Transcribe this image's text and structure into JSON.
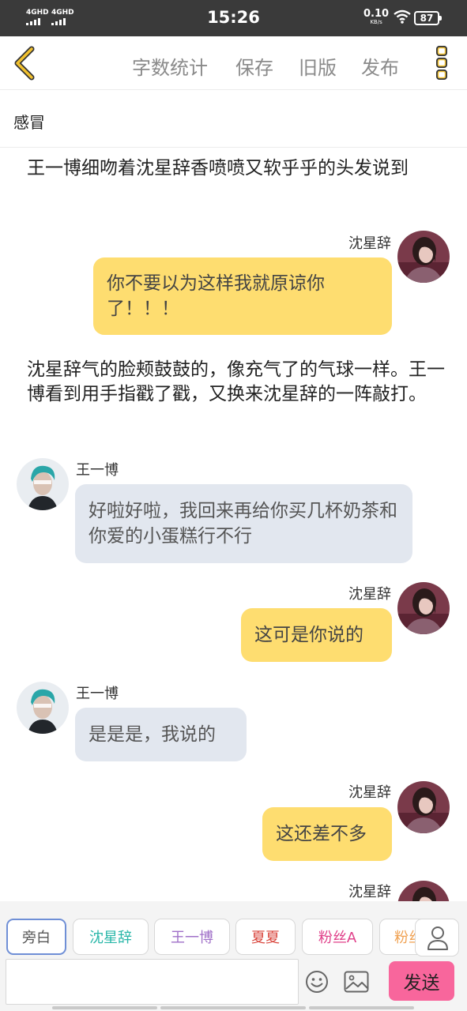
{
  "status_bar": {
    "signal1": "4GHD",
    "signal2": "4GHD",
    "time": "15:26",
    "net_speed": "0.10",
    "net_unit": "KB/s",
    "battery": "87"
  },
  "header": {
    "back_icon": "chevron-left-icon",
    "menu": [
      "字数统计",
      "保存",
      "旧版",
      "发布"
    ],
    "more_icon": "three-dots-vertical-icon",
    "accent": "#f2c12e"
  },
  "title": "感冒",
  "chat": {
    "narration_1": "王一博细吻着沈星辞香喷喷又软乎乎的头发说到",
    "narration_2": "沈星辞气的脸颊鼓鼓的，像充气了的气球一样。王一博看到用手指戳了戳，又换来沈星辞的一阵敲打。",
    "messages": [
      {
        "speaker": "沈星辞",
        "text": "你不要以为这样我就原谅你了！！！"
      },
      {
        "speaker": "王一博",
        "text": "好啦好啦，我回来再给你买几杯奶茶和你爱的小蛋糕行不行"
      },
      {
        "speaker": "沈星辞",
        "text": "这可是你说的"
      },
      {
        "speaker": "王一博",
        "text": "是是是，我说的"
      },
      {
        "speaker": "沈星辞",
        "text": "这还差不多"
      },
      {
        "speaker": "沈星辞",
        "text": ""
      }
    ],
    "bubble_me_color": "#fedd70",
    "bubble_other_color": "#e2e7ef"
  },
  "bottom": {
    "roles": [
      {
        "label": "旁白",
        "color": "#555555"
      },
      {
        "label": "沈星辞",
        "color": "#2ab7a9"
      },
      {
        "label": "王一博",
        "color": "#a070c8"
      },
      {
        "label": "夏夏",
        "color": "#d8433a"
      },
      {
        "label": "粉丝A",
        "color": "#e0408a"
      },
      {
        "label": "粉丝",
        "color": "#f0a050"
      }
    ],
    "role_icon": "person-icon",
    "emoji_icon": "smiley-icon",
    "image_icon": "image-icon",
    "send_label": "发送",
    "send_color": "#f8669c"
  }
}
